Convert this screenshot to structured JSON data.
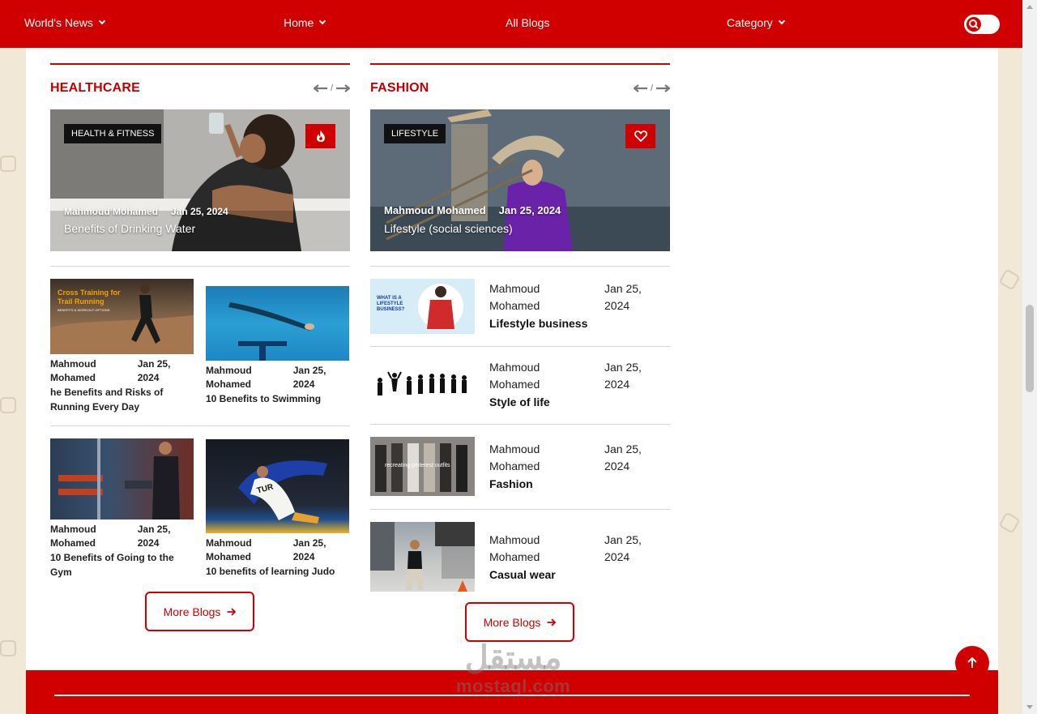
{
  "nav": {
    "brand": "World's News",
    "home": "Home",
    "all_blogs": "All Blogs",
    "category": "Category"
  },
  "healthcare": {
    "title": "HEALTHCARE",
    "slash": "/",
    "hero": {
      "tag": "HEALTH & FITNESS",
      "author": "Mahmoud Mohamed",
      "date": "Jan 25, 2024",
      "title": "Benefits of Drinking Water"
    },
    "cards": [
      {
        "author": "Mahmoud Mohamed",
        "date": "Jan 25, 2024",
        "title": "he Benefits and Risks of Running Every Day",
        "thumb_text": "Cross Training for Trail Running",
        "thumb_sub": "BENEFITS & WORKOUT OPTIONS"
      },
      {
        "author": "Mahmoud Mohamed",
        "date": "Jan 25, 2024",
        "title": "10 Benefits to Swimming"
      },
      {
        "author": "Mahmoud Mohamed",
        "date": "Jan 25, 2024",
        "title": "10 Benefits of Going to the Gym"
      },
      {
        "author": "Mahmoud Mohamed",
        "date": "Jan 25, 2024",
        "title": "10 benefits of learning Judo",
        "thumb_text": "TUR"
      }
    ],
    "more": "More Blogs"
  },
  "fashion": {
    "title": "FASHION",
    "slash": "/",
    "hero": {
      "tag": "LIFESTYLE",
      "author": "Mahmoud Mohamed",
      "date": "Jan 25, 2024",
      "title": "Lifestyle (social sciences)"
    },
    "items": [
      {
        "author": "Mahmoud Mohamed",
        "date": "Jan 25, 2024",
        "title": "Lifestyle business",
        "thumb_text": "WHAT IS A LIFESTYLE BUSINESS?"
      },
      {
        "author": "Mahmoud Mohamed",
        "date": "Jan 25, 2024",
        "title": "Style of life"
      },
      {
        "author": "Mahmoud Mohamed",
        "date": "Jan 25, 2024",
        "title": "Fashion",
        "thumb_text": "recreating pinterest outfits"
      },
      {
        "author": "Mahmoud Mohamed",
        "date": "Jan 25, 2024",
        "title": "Casual wear"
      }
    ],
    "more": "More Blogs"
  },
  "watermark": {
    "arabic": "مستقل",
    "latin": "mostaql.com"
  },
  "colors": {
    "brand_red": "#d10000",
    "section_title": "#c00000",
    "page_bg": "#f1e8d8"
  },
  "icons": [
    "chevron-down-icon",
    "search-icon",
    "flame-icon",
    "heart-icon",
    "arrow-left-icon",
    "arrow-right-icon",
    "arrow-up-icon"
  ]
}
